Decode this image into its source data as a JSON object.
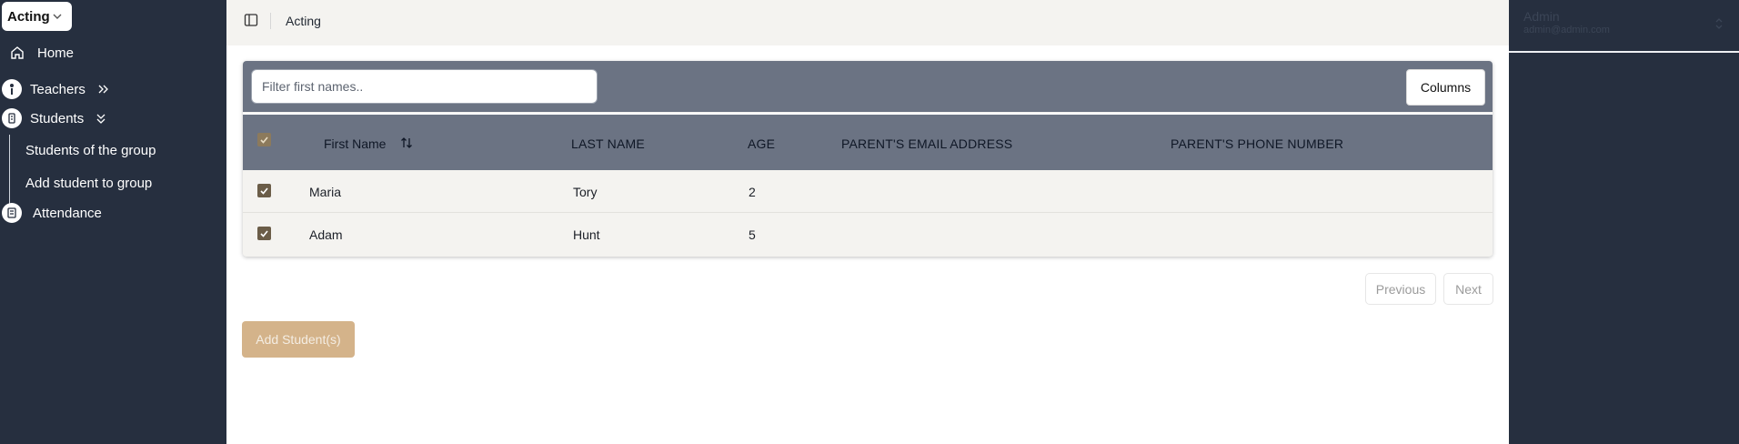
{
  "sidebar": {
    "group_select": "Acting",
    "items": {
      "home": "Home",
      "teachers": "Teachers",
      "students": "Students",
      "attendance": "Attendance"
    },
    "students_submenu": [
      "Students of the group",
      "Add student to group"
    ]
  },
  "topbar": {
    "breadcrumb": "Acting"
  },
  "table": {
    "filter_placeholder": "Filter first names..",
    "columns_label": "Columns",
    "headers": {
      "first_name": "First Name",
      "last_name": "LAST NAME",
      "age": "AGE",
      "email": "PARENT'S EMAIL ADDRESS",
      "phone": "PARENT'S PHONE NUMBER"
    },
    "rows": [
      {
        "first_name": "Maria",
        "last_name": "Tory",
        "age": "2",
        "email": "",
        "phone": "",
        "checked": true
      },
      {
        "first_name": "Adam",
        "last_name": "Hunt",
        "age": "5",
        "email": "",
        "phone": "",
        "checked": true
      }
    ]
  },
  "pagination": {
    "previous": "Previous",
    "next": "Next"
  },
  "actions": {
    "add_students": "Add Student(s)"
  },
  "user": {
    "name": "Admin",
    "email": "admin@admin.com"
  },
  "colors": {
    "sidebar_bg": "#262f3f",
    "table_header_bg": "#6b7383",
    "checkbox": "#6b5d48",
    "add_button": "#d4b38a"
  }
}
